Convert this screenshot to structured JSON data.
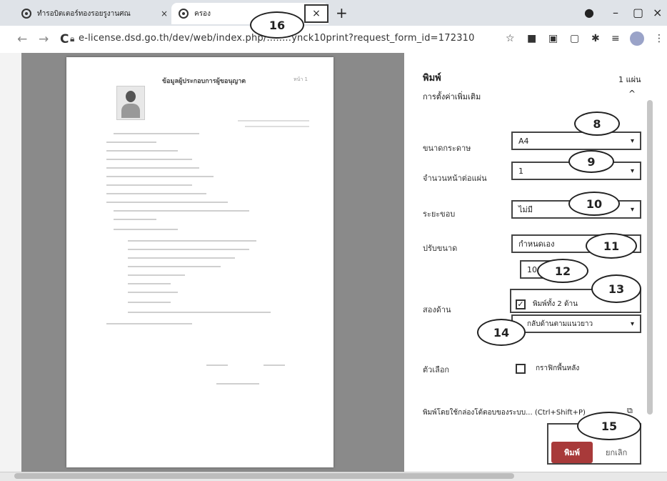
{
  "browser": {
    "tabs": [
      {
        "title": "ทำรอบิตเตอร์ทองรอยรูงานศณ",
        "close": "×"
      },
      {
        "title": "ครอง",
        "close": "×"
      }
    ],
    "new_tab": "+",
    "window_controls": {
      "minimize": "–",
      "maximize": "▢",
      "close": "×"
    },
    "nav": {
      "back": "←",
      "forward": "→",
      "reload": "C"
    },
    "url": "e-license.dsd.go.th/dev/web/index.php/........ynck10print?request_form_id=172310"
  },
  "document": {
    "title": "ข้อมูลผู้ประกอบการผู้ขอนุญาต",
    "header_right": "หน้า 1"
  },
  "print_panel": {
    "heading": "พิมพ์",
    "sheets": "1 แผ่น",
    "more_settings": "การตั้งค่าเพิ่มเติม",
    "paper_size_label": "ขนาดกระดาษ",
    "paper_size_value": "A4",
    "pages_per_sheet_label": "จำนวนหน้าต่อแผ่น",
    "pages_per_sheet_value": "1",
    "margins_label": "ระยะขอบ",
    "margins_value": "ไม่มี",
    "scale_label": "ปรับขนาด",
    "scale_value": "กำหนดเอง",
    "scale_percent": "100",
    "two_sided_label": "สองด้าน",
    "two_sided_option": "พิมพ์ทั้ง 2 ด้าน",
    "flip_option": "กลับด้านตามแนวยาว",
    "options_label": "ตัวเลือก",
    "background_option": "กราฟิกพื้นหลัง",
    "system_dialog": "พิมพ์โดยใช้กล่องโต้ตอบของระบบ... (Ctrl+Shift+P)",
    "print_button": "พิมพ์",
    "cancel_button": "ยกเลิก"
  },
  "callouts": [
    "8",
    "9",
    "10",
    "11",
    "12",
    "13",
    "14",
    "15",
    "16"
  ]
}
